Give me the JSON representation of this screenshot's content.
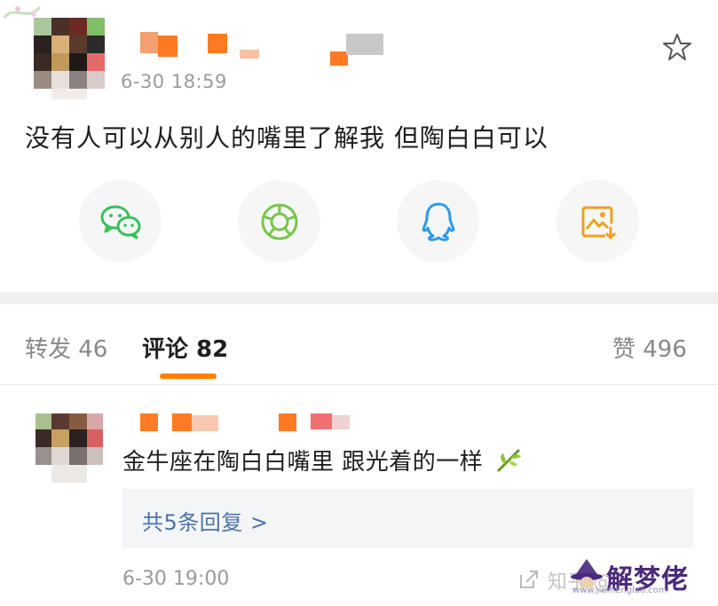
{
  "post": {
    "time": "6-30 18:59",
    "text": "没有人可以从别人的嘴里了解我 但陶白白可以"
  },
  "share": {
    "icons": [
      "wechat-icon",
      "moments-icon",
      "qq-icon",
      "save-image-icon"
    ]
  },
  "tabs": {
    "repost": "转发 46",
    "comments": "评论 82",
    "likes": "赞 496"
  },
  "comment": {
    "text": "金牛座在陶白白嘴里 跟光着的一样",
    "reply_link": "共5条回复 >",
    "time": "6-30 19:00"
  },
  "watermark": {
    "prefix": "知乎 @",
    "brand": "解梦佬",
    "url": "www.jiemenglao.com"
  },
  "colors": {
    "accent": "#ff8200",
    "link": "#4b73a6",
    "muted": "#9a9a9a",
    "divider": "#efefef"
  }
}
